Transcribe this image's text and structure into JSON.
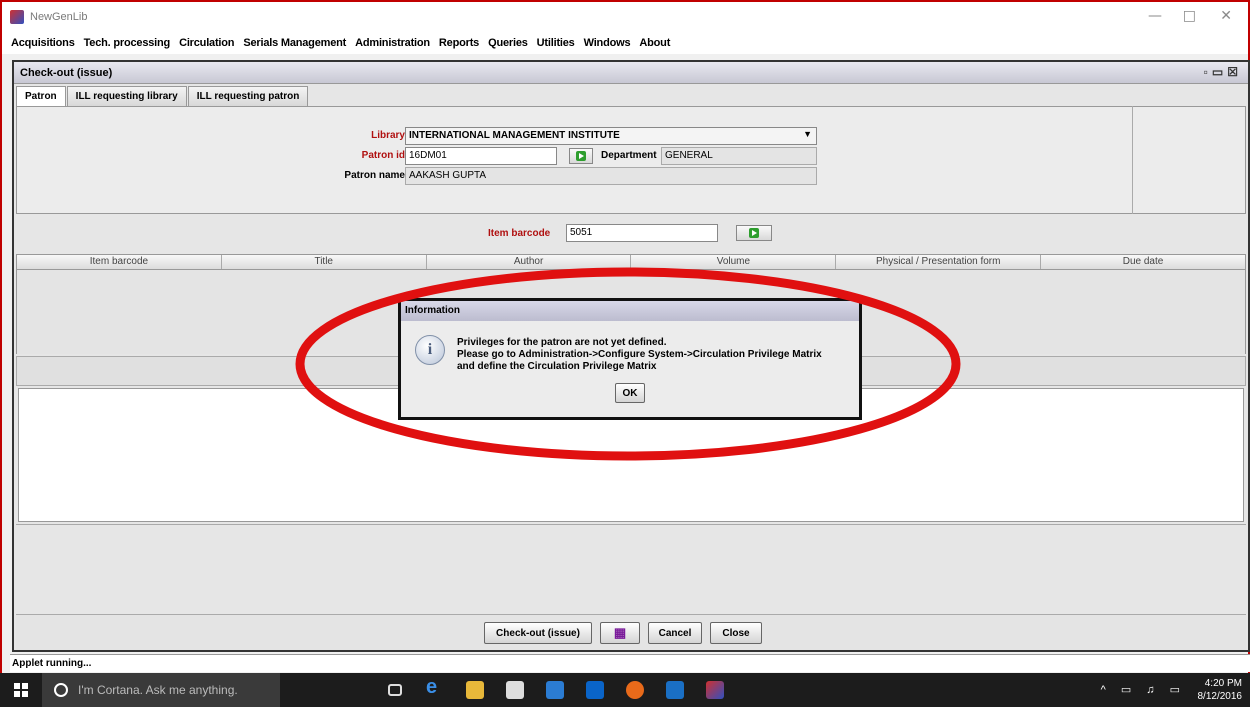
{
  "window": {
    "title": "NewGenLib"
  },
  "menu": [
    "Acquisitions",
    "Tech. processing",
    "Circulation",
    "Serials Management",
    "Administration",
    "Reports",
    "Queries",
    "Utilities",
    "Windows",
    "About"
  ],
  "frame": {
    "title": "Check-out (issue)"
  },
  "tabs": [
    "Patron",
    "ILL requesting library",
    "ILL requesting patron"
  ],
  "form": {
    "library_label": "Library",
    "library_value": "INTERNATIONAL MANAGEMENT INSTITUTE",
    "patron_id_label": "Patron id",
    "patron_id_value": "16DM01",
    "department_label": "Department",
    "department_value": "GENERAL",
    "patron_name_label": "Patron name",
    "patron_name_value": "AAKASH  GUPTA",
    "item_barcode_label": "Item barcode",
    "item_barcode_value": "5051"
  },
  "table": {
    "columns": [
      "Item barcode",
      "Title",
      "Author",
      "Volume",
      "Physical / Presentation form",
      "Due date"
    ]
  },
  "buttons": {
    "checkout": "Check-out (issue)",
    "cancel": "Cancel",
    "close": "Close"
  },
  "dialog": {
    "title": "Information",
    "icon": "i",
    "line1": "Privileges for the patron are not yet defined.",
    "line2": "Please go to Administration->Configure System->Circulation Privilege Matrix",
    "line3": "and define the Circulation Privilege Matrix",
    "ok": "OK"
  },
  "status": "Applet running...",
  "taskbar": {
    "search_placeholder": "I'm Cortana. Ask me anything.",
    "time": "4:20 PM",
    "date": "8/12/2016"
  },
  "colors": {
    "highlight_ring": "#e01010",
    "required_label": "#b01010",
    "taskbar": "#1c1c1c"
  }
}
